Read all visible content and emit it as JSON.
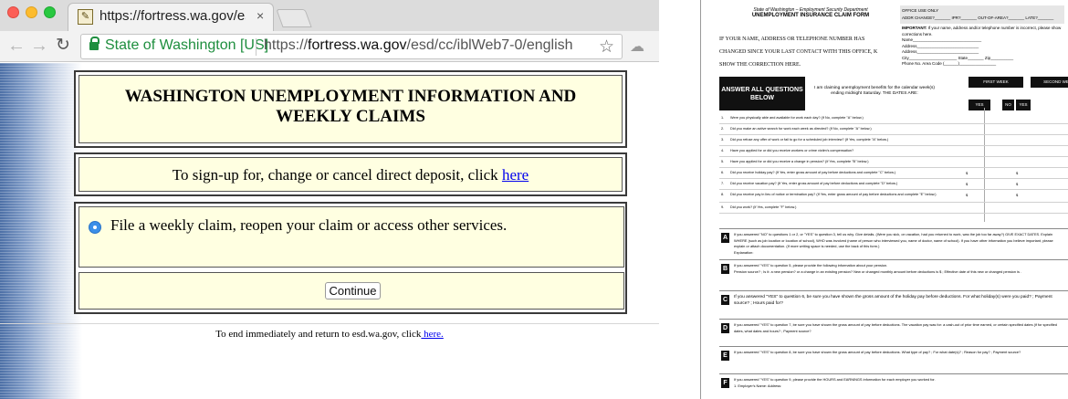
{
  "browser": {
    "tab_title": "https://fortress.wa.gov/esd/cc",
    "tab_close_label": "×",
    "site_identity": "State of Washington [US]",
    "url_prefix": "https://",
    "url_domain": "fortress.wa.gov",
    "url_path": "/esd/cc/iblWeb7-0/english"
  },
  "page": {
    "heading": "WASHINGTON UNEMPLOYMENT INFORMATION AND WEEKLY CLAIMS",
    "deposit_text": "To sign-up for, change or cancel direct deposit, click ",
    "deposit_link": "here",
    "claim_option": "File a weekly claim, reopen your claim or access other services.",
    "continue_label": "Continue",
    "footer_text": "To end immediately and return to esd.wa.gov, click",
    "footer_link": " here."
  },
  "form": {
    "agency": "State of Washington – Employment Security Department",
    "title": "UNEMPLOYMENT INSURANCE CLAIM FORM",
    "office_use": "OFFICE USE ONLY",
    "office_fields": "ADDR CHANGE?_______ IPR?_______ OUT-OF-AREA?_______ LATE?_______",
    "change_notice": "IF YOUR NAME, ADDRESS OR TELEPHONE NUMBER HAS CHANGED SINCE YOUR LAST CONTACT WITH THIS OFFICE, K SHOW THE CORRECTION HERE.",
    "important_label": "IMPORTANT:",
    "important_text": " If your name, address and/or telephone number is incorrect, please show corrections here.",
    "addr_name": "Name______________________________",
    "addr_address": "Address___________________________",
    "addr_address2": "Address___________________________",
    "addr_city": "City_____________________ State_______ Zip__________",
    "addr_phone": "Phone No. Area Code (______)________________",
    "answer_all": "ANSWER ALL QUESTIONS BELOW",
    "claim_statement": "I am claiming unemployment benefits for the calendar week(s) ending midnight Saturday.  THE DATES ARE:",
    "first_week": "FIRST WEEK",
    "second_week": "SECOND WEEK",
    "yes": "YES",
    "no": "NO",
    "questions": [
      {
        "num": "1.",
        "text": "Were you physically able and available for work each day?  (If No, complete \"A\" below.)"
      },
      {
        "num": "2.",
        "text": "Did you make an active search for work each week as directed?  (If No, complete \"A\" below.)"
      },
      {
        "num": "3.",
        "text": "Did you refuse any offer of work or fail to go for a scheduled job interview?  (If Yes, complete \"A\" below.)"
      },
      {
        "num": "4.",
        "text": "Have you applied for or did you receive workers or crime victim's compensation?"
      },
      {
        "num": "5.",
        "text": "Have you applied for or did you receive a change in pension?  (If Yes, complete \"B\" below.)"
      },
      {
        "num": "6.",
        "text": "Did you receive holiday pay?  (If Yes, enter gross amount of pay before deductions and complete \"C\" below.)"
      },
      {
        "num": "7.",
        "text": "Did you receive vacation pay?  (If Yes, enter gross amount of pay before deductions and complete \"D\" below.)"
      },
      {
        "num": "8.",
        "text": "Did you receive pay in lieu of notice or termination pay?  (If Yes, enter gross amount of pay before deductions and complete \"E\" below.)"
      },
      {
        "num": "9.",
        "text": "Did you work?  (If Yes, complete \"F\" below.)"
      }
    ],
    "dollar": "$",
    "sections": [
      {
        "letter": "A",
        "text": "If you answered \"NO\" to questions 1 or 2, or \"YES\" to question 3, tell us why.  Give details.  (Were you sick, on vacation, had you returned to work, was the job too far away?)  GIVE EXACT DATES.  Explain WHERE (such as job location or location of school), WHO was involved (name of person who interviewed you, name of doctor, name of school).  If you have other information you believe important, please explain or attach documentation.  (If more writing space is needed, use the back of this form.)",
        "extra": "Explanation:"
      },
      {
        "letter": "B",
        "text": "If you answered \"YES\" to question 5, please provide the following information about your pension.",
        "extra": "Pension source?          ;  Is it:    a new pension?    or    a change in an existing pension?       New or changed monthly amount before deductions is $          ;  Effective date of this new or changed pension is          ."
      },
      {
        "letter": "C",
        "text": "If you answered \"YES\" to question 6, be sure you have shown the gross amount of the holiday pay before deductions.  For what holiday(s) were you paid?          ;  Payment source?          ;  Hours paid for?",
        "extra": ""
      },
      {
        "letter": "D",
        "text": "If you answered \"YES\" to question 7, be sure you have shown the gross amount of pay before deductions.  The vacation pay was for:  a cash-out of prior time earned, or  certain specified dates (if for specified dates, what dates and hours?          ;  Payment source?",
        "extra": ""
      },
      {
        "letter": "E",
        "text": "If you answered \"YES\" to question 8, be sure you have shown the gross amount of pay before deductions.  What type of pay?          ;  For what date(s)?          ;  Reason for pay?          ;  Payment source?",
        "extra": ""
      },
      {
        "letter": "F",
        "text": "If you answered \"YES\" to question 9, please provide the HOURS and EARNINGS information for each employer you worked for.",
        "extra": "1.   Employer's Name:                    Address:"
      }
    ]
  },
  "colors": {
    "panel_bg": "#ffffe1",
    "link": "#0000ee",
    "secure_green": "#1e8e3e"
  }
}
